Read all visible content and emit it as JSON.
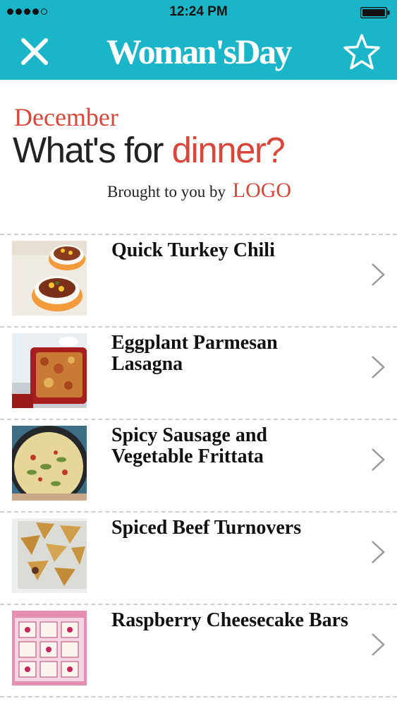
{
  "status_bar": {
    "time": "12:24 PM",
    "signal_bars": 5,
    "signal_filled": 4
  },
  "header": {
    "brand": "Woman'sDay",
    "close_icon": "close-icon",
    "favorite_icon": "star-outline-icon",
    "background_color": "#1ab5c9"
  },
  "promo": {
    "month": "December",
    "title_main": "What's for ",
    "title_accent": "dinner?",
    "sponsor_prefix": "Brought to you by",
    "sponsor_logo": "LOGO",
    "accent_color": "#d9473b"
  },
  "recipes": [
    {
      "title": "Quick Turkey Chili",
      "thumbnail": "turkey-chili-photo"
    },
    {
      "title": "Eggplant Parmesan Lasagna",
      "thumbnail": "eggplant-lasagna-photo"
    },
    {
      "title": "Spicy Sausage and Vegetable Frittata",
      "thumbnail": "frittata-photo"
    },
    {
      "title": "Spiced Beef Turnovers",
      "thumbnail": "beef-turnovers-photo"
    },
    {
      "title": "Raspberry Cheesecake Bars",
      "thumbnail": "cheesecake-bars-photo"
    }
  ]
}
